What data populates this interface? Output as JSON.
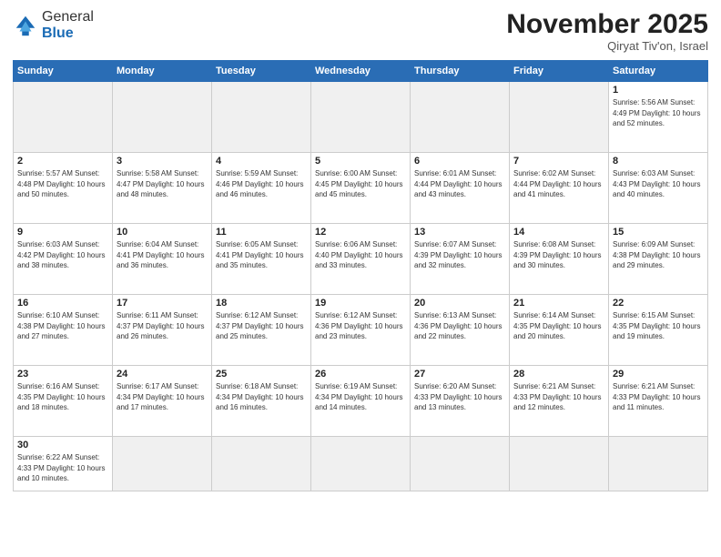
{
  "header": {
    "logo_general": "General",
    "logo_blue": "Blue",
    "month_title": "November 2025",
    "location": "Qiryat Tiv'on, Israel"
  },
  "weekdays": [
    "Sunday",
    "Monday",
    "Tuesday",
    "Wednesday",
    "Thursday",
    "Friday",
    "Saturday"
  ],
  "weeks": [
    [
      {
        "day": "",
        "info": ""
      },
      {
        "day": "",
        "info": ""
      },
      {
        "day": "",
        "info": ""
      },
      {
        "day": "",
        "info": ""
      },
      {
        "day": "",
        "info": ""
      },
      {
        "day": "",
        "info": ""
      },
      {
        "day": "1",
        "info": "Sunrise: 5:56 AM\nSunset: 4:49 PM\nDaylight: 10 hours\nand 52 minutes."
      }
    ],
    [
      {
        "day": "2",
        "info": "Sunrise: 5:57 AM\nSunset: 4:48 PM\nDaylight: 10 hours\nand 50 minutes."
      },
      {
        "day": "3",
        "info": "Sunrise: 5:58 AM\nSunset: 4:47 PM\nDaylight: 10 hours\nand 48 minutes."
      },
      {
        "day": "4",
        "info": "Sunrise: 5:59 AM\nSunset: 4:46 PM\nDaylight: 10 hours\nand 46 minutes."
      },
      {
        "day": "5",
        "info": "Sunrise: 6:00 AM\nSunset: 4:45 PM\nDaylight: 10 hours\nand 45 minutes."
      },
      {
        "day": "6",
        "info": "Sunrise: 6:01 AM\nSunset: 4:44 PM\nDaylight: 10 hours\nand 43 minutes."
      },
      {
        "day": "7",
        "info": "Sunrise: 6:02 AM\nSunset: 4:44 PM\nDaylight: 10 hours\nand 41 minutes."
      },
      {
        "day": "8",
        "info": "Sunrise: 6:03 AM\nSunset: 4:43 PM\nDaylight: 10 hours\nand 40 minutes."
      }
    ],
    [
      {
        "day": "9",
        "info": "Sunrise: 6:03 AM\nSunset: 4:42 PM\nDaylight: 10 hours\nand 38 minutes."
      },
      {
        "day": "10",
        "info": "Sunrise: 6:04 AM\nSunset: 4:41 PM\nDaylight: 10 hours\nand 36 minutes."
      },
      {
        "day": "11",
        "info": "Sunrise: 6:05 AM\nSunset: 4:41 PM\nDaylight: 10 hours\nand 35 minutes."
      },
      {
        "day": "12",
        "info": "Sunrise: 6:06 AM\nSunset: 4:40 PM\nDaylight: 10 hours\nand 33 minutes."
      },
      {
        "day": "13",
        "info": "Sunrise: 6:07 AM\nSunset: 4:39 PM\nDaylight: 10 hours\nand 32 minutes."
      },
      {
        "day": "14",
        "info": "Sunrise: 6:08 AM\nSunset: 4:39 PM\nDaylight: 10 hours\nand 30 minutes."
      },
      {
        "day": "15",
        "info": "Sunrise: 6:09 AM\nSunset: 4:38 PM\nDaylight: 10 hours\nand 29 minutes."
      }
    ],
    [
      {
        "day": "16",
        "info": "Sunrise: 6:10 AM\nSunset: 4:38 PM\nDaylight: 10 hours\nand 27 minutes."
      },
      {
        "day": "17",
        "info": "Sunrise: 6:11 AM\nSunset: 4:37 PM\nDaylight: 10 hours\nand 26 minutes."
      },
      {
        "day": "18",
        "info": "Sunrise: 6:12 AM\nSunset: 4:37 PM\nDaylight: 10 hours\nand 25 minutes."
      },
      {
        "day": "19",
        "info": "Sunrise: 6:12 AM\nSunset: 4:36 PM\nDaylight: 10 hours\nand 23 minutes."
      },
      {
        "day": "20",
        "info": "Sunrise: 6:13 AM\nSunset: 4:36 PM\nDaylight: 10 hours\nand 22 minutes."
      },
      {
        "day": "21",
        "info": "Sunrise: 6:14 AM\nSunset: 4:35 PM\nDaylight: 10 hours\nand 20 minutes."
      },
      {
        "day": "22",
        "info": "Sunrise: 6:15 AM\nSunset: 4:35 PM\nDaylight: 10 hours\nand 19 minutes."
      }
    ],
    [
      {
        "day": "23",
        "info": "Sunrise: 6:16 AM\nSunset: 4:35 PM\nDaylight: 10 hours\nand 18 minutes."
      },
      {
        "day": "24",
        "info": "Sunrise: 6:17 AM\nSunset: 4:34 PM\nDaylight: 10 hours\nand 17 minutes."
      },
      {
        "day": "25",
        "info": "Sunrise: 6:18 AM\nSunset: 4:34 PM\nDaylight: 10 hours\nand 16 minutes."
      },
      {
        "day": "26",
        "info": "Sunrise: 6:19 AM\nSunset: 4:34 PM\nDaylight: 10 hours\nand 14 minutes."
      },
      {
        "day": "27",
        "info": "Sunrise: 6:20 AM\nSunset: 4:33 PM\nDaylight: 10 hours\nand 13 minutes."
      },
      {
        "day": "28",
        "info": "Sunrise: 6:21 AM\nSunset: 4:33 PM\nDaylight: 10 hours\nand 12 minutes."
      },
      {
        "day": "29",
        "info": "Sunrise: 6:21 AM\nSunset: 4:33 PM\nDaylight: 10 hours\nand 11 minutes."
      }
    ],
    [
      {
        "day": "30",
        "info": "Sunrise: 6:22 AM\nSunset: 4:33 PM\nDaylight: 10 hours\nand 10 minutes."
      },
      {
        "day": "",
        "info": ""
      },
      {
        "day": "",
        "info": ""
      },
      {
        "day": "",
        "info": ""
      },
      {
        "day": "",
        "info": ""
      },
      {
        "day": "",
        "info": ""
      },
      {
        "day": "",
        "info": ""
      }
    ]
  ]
}
